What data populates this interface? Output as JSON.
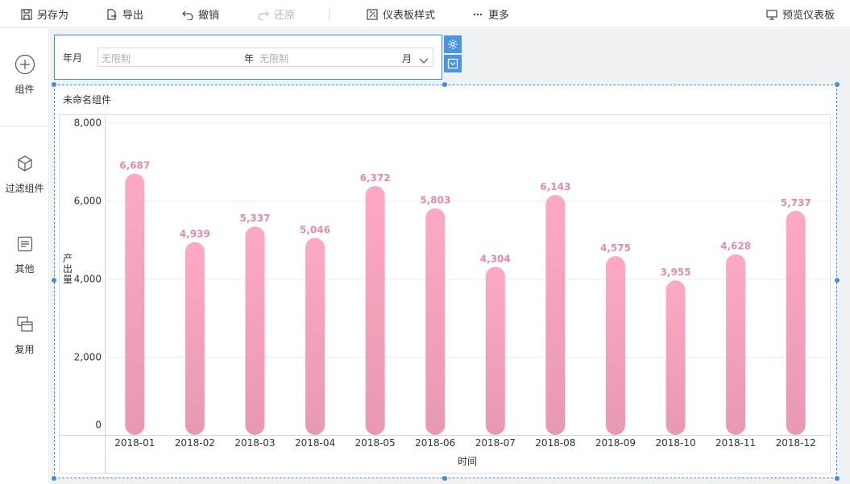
{
  "toolbar": {
    "save_as": "另存为",
    "export": "导出",
    "undo": "撤销",
    "redo": "还原",
    "dashboard_style": "仪表板样式",
    "more": "更多",
    "preview": "预览仪表板"
  },
  "left_panel": {
    "items": [
      {
        "label": "组件",
        "icon": "plus-circle-icon"
      },
      {
        "label": "过滤组件",
        "icon": "cube-icon"
      },
      {
        "label": "其他",
        "icon": "document-icon"
      },
      {
        "label": "复用",
        "icon": "copy-icon"
      }
    ]
  },
  "filter": {
    "label": "年月",
    "start_placeholder": "无限制",
    "start_unit": "年",
    "end_placeholder": "无限制",
    "end_unit": "月"
  },
  "widget": {
    "title": "未命名组件"
  },
  "colors": {
    "accent": "#3d8fe0",
    "bar_top": "#fda9c4",
    "bar_bottom": "#e899b2",
    "label": "#e58ba8"
  },
  "chart_data": {
    "type": "bar",
    "categories": [
      "2018-01",
      "2018-02",
      "2018-03",
      "2018-04",
      "2018-05",
      "2018-06",
      "2018-07",
      "2018-08",
      "2018-09",
      "2018-10",
      "2018-11",
      "2018-12"
    ],
    "values": [
      6687,
      4939,
      5337,
      5046,
      6372,
      5803,
      4304,
      6143,
      4575,
      3955,
      4628,
      5737
    ],
    "value_labels": [
      "6,687",
      "4,939",
      "5,337",
      "5,046",
      "6,372",
      "5,803",
      "4,304",
      "6,143",
      "4,575",
      "3,955",
      "4,628",
      "5,737"
    ],
    "yticks": [
      "0",
      "2,000",
      "4,000",
      "6,000",
      "8,000"
    ],
    "ytick_values": [
      0,
      2000,
      4000,
      6000,
      8000
    ],
    "ylim": [
      0,
      8000
    ],
    "xlabel": "时间",
    "ylabel": "产出量",
    "grid": true
  }
}
